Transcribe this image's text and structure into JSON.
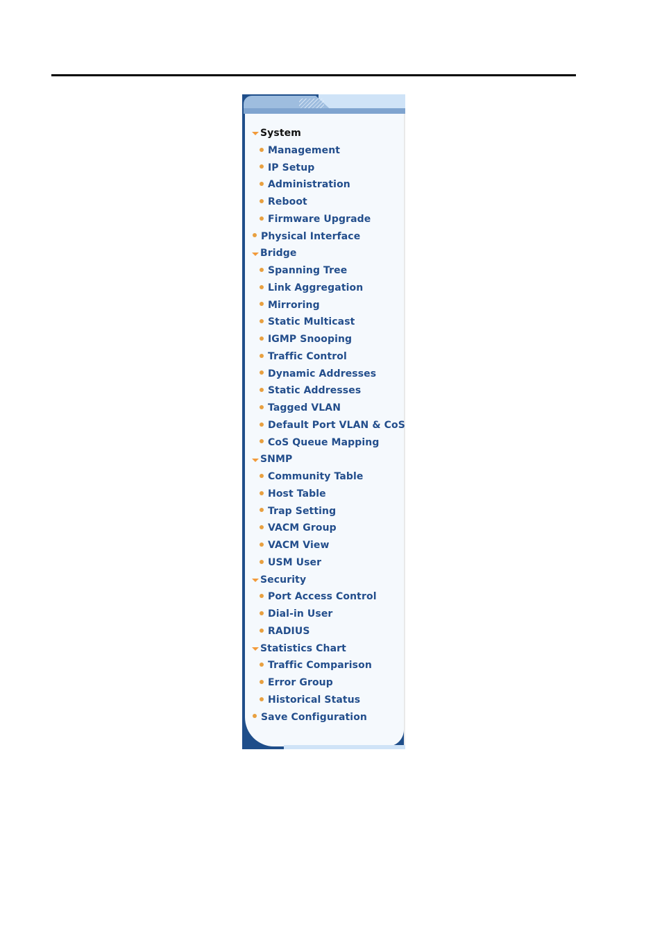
{
  "colors": {
    "link": "#234e8c",
    "active": "#111111",
    "bullet": "#e8a040",
    "arrow": "#f29a3a",
    "panel_dark": "#1f4e8a",
    "panel_light": "#f5f9fd"
  },
  "menu": [
    {
      "label": "System",
      "type": "group",
      "expanded": true,
      "active": true,
      "icon": "expand-arrow-icon"
    },
    {
      "label": "Management",
      "type": "sub",
      "icon": "bullet-icon"
    },
    {
      "label": "IP Setup",
      "type": "sub",
      "icon": "bullet-icon"
    },
    {
      "label": "Administration",
      "type": "sub",
      "icon": "bullet-icon"
    },
    {
      "label": "Reboot",
      "type": "sub",
      "icon": "bullet-icon"
    },
    {
      "label": "Firmware Upgrade",
      "type": "sub",
      "icon": "bullet-icon"
    },
    {
      "label": "Physical Interface",
      "type": "top",
      "icon": "bullet-icon"
    },
    {
      "label": "Bridge",
      "type": "group",
      "expanded": true,
      "icon": "expand-arrow-icon"
    },
    {
      "label": "Spanning Tree",
      "type": "sub",
      "icon": "bullet-icon"
    },
    {
      "label": "Link Aggregation",
      "type": "sub",
      "icon": "bullet-icon"
    },
    {
      "label": "Mirroring",
      "type": "sub",
      "icon": "bullet-icon"
    },
    {
      "label": "Static Multicast",
      "type": "sub",
      "icon": "bullet-icon"
    },
    {
      "label": "IGMP Snooping",
      "type": "sub",
      "icon": "bullet-icon"
    },
    {
      "label": "Traffic Control",
      "type": "sub",
      "icon": "bullet-icon"
    },
    {
      "label": "Dynamic Addresses",
      "type": "sub",
      "icon": "bullet-icon"
    },
    {
      "label": "Static Addresses",
      "type": "sub",
      "icon": "bullet-icon"
    },
    {
      "label": "Tagged VLAN",
      "type": "sub",
      "icon": "bullet-icon"
    },
    {
      "label": "Default Port VLAN & CoS",
      "type": "sub",
      "icon": "bullet-icon"
    },
    {
      "label": "CoS Queue Mapping",
      "type": "sub",
      "icon": "bullet-icon"
    },
    {
      "label": "SNMP",
      "type": "group",
      "expanded": true,
      "icon": "expand-arrow-icon"
    },
    {
      "label": "Community Table",
      "type": "sub",
      "icon": "bullet-icon"
    },
    {
      "label": "Host Table",
      "type": "sub",
      "icon": "bullet-icon"
    },
    {
      "label": "Trap Setting",
      "type": "sub",
      "icon": "bullet-icon"
    },
    {
      "label": "VACM Group",
      "type": "sub",
      "icon": "bullet-icon"
    },
    {
      "label": "VACM View",
      "type": "sub",
      "icon": "bullet-icon"
    },
    {
      "label": "USM User",
      "type": "sub",
      "icon": "bullet-icon"
    },
    {
      "label": "Security",
      "type": "group",
      "expanded": true,
      "icon": "expand-arrow-icon"
    },
    {
      "label": "Port Access Control",
      "type": "sub",
      "icon": "bullet-icon"
    },
    {
      "label": "Dial-in User",
      "type": "sub",
      "icon": "bullet-icon"
    },
    {
      "label": "RADIUS",
      "type": "sub",
      "icon": "bullet-icon"
    },
    {
      "label": "Statistics Chart",
      "type": "group",
      "expanded": true,
      "icon": "expand-arrow-icon"
    },
    {
      "label": "Traffic Comparison",
      "type": "sub",
      "icon": "bullet-icon"
    },
    {
      "label": "Error Group",
      "type": "sub",
      "icon": "bullet-icon"
    },
    {
      "label": "Historical Status",
      "type": "sub",
      "icon": "bullet-icon"
    },
    {
      "label": "Save Configuration",
      "type": "top",
      "icon": "bullet-icon"
    }
  ]
}
